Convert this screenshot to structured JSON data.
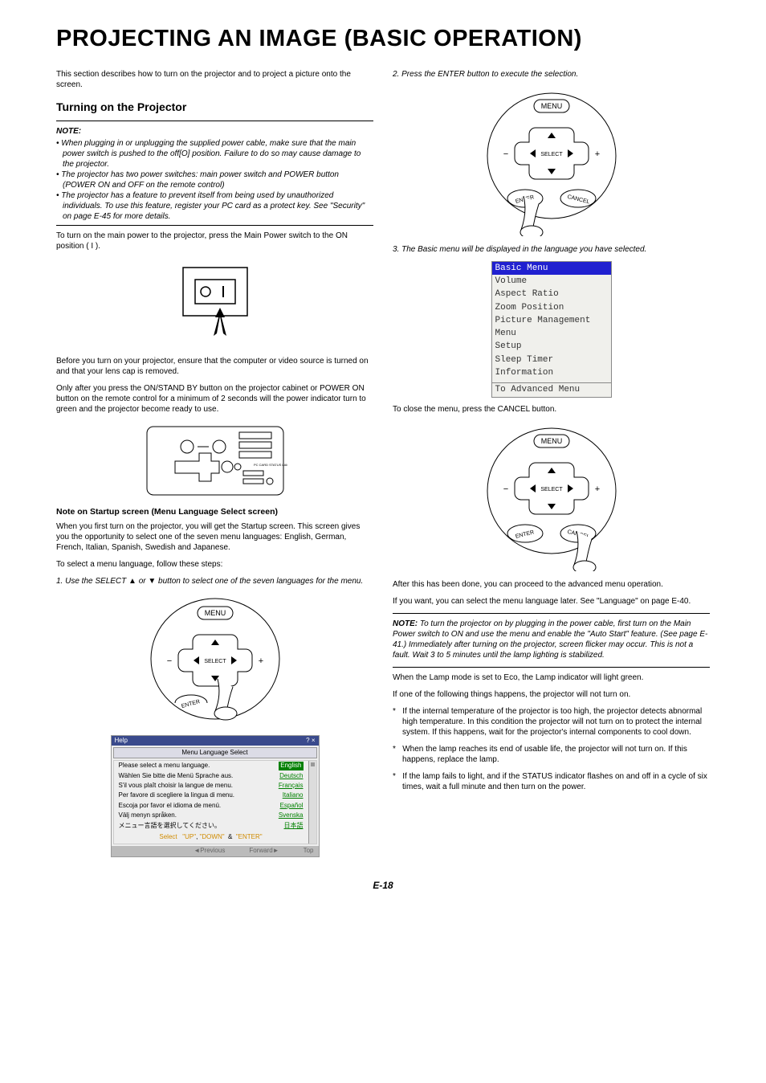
{
  "title": "PROJECTING AN IMAGE (BASIC OPERATION)",
  "intro": "This section describes how to turn on the projector and to project a picture onto the screen.",
  "section1": {
    "heading": "Turning on the Projector",
    "note_label": "NOTE:",
    "notes": [
      "When plugging in or unplugging the supplied power cable, make sure that the main power switch is pushed to the off[O] position. Failure to do so may cause damage to the projector.",
      "The projector has two power switches: main power switch and POWER button (POWER ON and OFF on the remote control)",
      "The projector has a feature to prevent itself from being used by unauthorized individuals. To use this feature, register your PC card as a protect key. See \"Security\" on page E-45 for more details."
    ],
    "p1": "To turn on the main power to the projector, press the Main Power switch to the ON position ( I ).",
    "p2": "Before you turn on your projector, ensure that the computer or video source is turned on and that your lens cap is removed.",
    "p3": "Only after you press the ON/STAND BY button on the projector cabinet or POWER ON button on the remote control for a minimum of 2 seconds will the power indicator turn to green and the projector become ready to use.",
    "startup_heading": "Note on Startup screen (Menu Language Select screen)",
    "startup_p1": "When you first turn on the projector, you will get the Startup screen. This screen gives you the opportunity to select one of the seven menu languages: English, German, French, Italian, Spanish, Swedish and Japanese.",
    "startup_p2": "To select a menu language, follow these steps:",
    "step1": "1. Use the SELECT ▲ or ▼ button to select one of the seven languages for the menu."
  },
  "langbox": {
    "title": "Help",
    "sub": "Menu Language Select",
    "rows": [
      {
        "prompt": "Please select a menu language.",
        "lang": "English",
        "sel": true
      },
      {
        "prompt": "Wählen Sie bitte die Menü Sprache aus.",
        "lang": "Deutsch",
        "sel": false
      },
      {
        "prompt": "S'il vous plaît choisir la langue de menu.",
        "lang": "Français",
        "sel": false
      },
      {
        "prompt": "Per favore di scegliere la lingua di menu.",
        "lang": "Italiano",
        "sel": false
      },
      {
        "prompt": "Escoja por favor el idioma de menú.",
        "lang": "Español",
        "sel": false
      },
      {
        "prompt": "Välj menyn språken.",
        "lang": "Svenska",
        "sel": false
      },
      {
        "prompt": "メニュー言語を選択してください。",
        "lang": "日本語",
        "sel": false
      }
    ],
    "select_label": "Select",
    "select_opts": [
      "\"UP\"",
      "\"DOWN\"",
      "&",
      "\"ENTER\""
    ],
    "bottom": [
      "◄Previous",
      "Forward►",
      "Top"
    ]
  },
  "col2": {
    "step2": "2. Press the ENTER button to execute the selection.",
    "step3": "3. The Basic menu will be displayed in the language you have selected.",
    "basicmenu": {
      "title": "Basic Menu",
      "items": [
        "Volume",
        "Aspect Ratio",
        "Zoom Position",
        "Picture Management",
        "Menu",
        "Setup",
        "Sleep Timer",
        "Information"
      ],
      "footer": "To Advanced Menu"
    },
    "close_p": "To close the menu, press the CANCEL button.",
    "after_p1": "After this has been done, you can proceed to the advanced menu operation.",
    "after_p2": "If you want, you can select the menu language later. See \"Language\" on page E-40.",
    "note_label": "NOTE:",
    "note_body": " To turn the projector on by plugging in the power cable, first turn on the Main Power switch to ON and use the menu and enable the \"Auto Start\" feature. (See page E-41.) Immediately after turning on the projector, screen flicker may occur. This is not a fault. Wait 3 to 5 minutes until the lamp lighting is stabilized.",
    "lamp_p": "When the Lamp mode is set to Eco, the Lamp indicator will light green.",
    "lamp_p2": "If one of the following things happens, the projector will not turn on.",
    "bullets": [
      "If the internal temperature of the projector is too high, the projector detects abnormal high temperature. In this condition the projector will not turn on to protect the internal system. If this happens, wait for the projector's internal components to cool down.",
      "When the lamp reaches its end of usable life, the projector will not turn on. If this happens, replace the lamp.",
      "If the lamp fails to light, and if the STATUS indicator flashes on and off in a cycle of six times, wait a full minute and then turn on the power."
    ]
  },
  "dpad_labels": {
    "menu": "MENU",
    "select": "SELECT",
    "enter": "ENTER",
    "cancel": "CANCEL",
    "minus": "−",
    "plus": "+"
  },
  "pagenum": "E-18"
}
